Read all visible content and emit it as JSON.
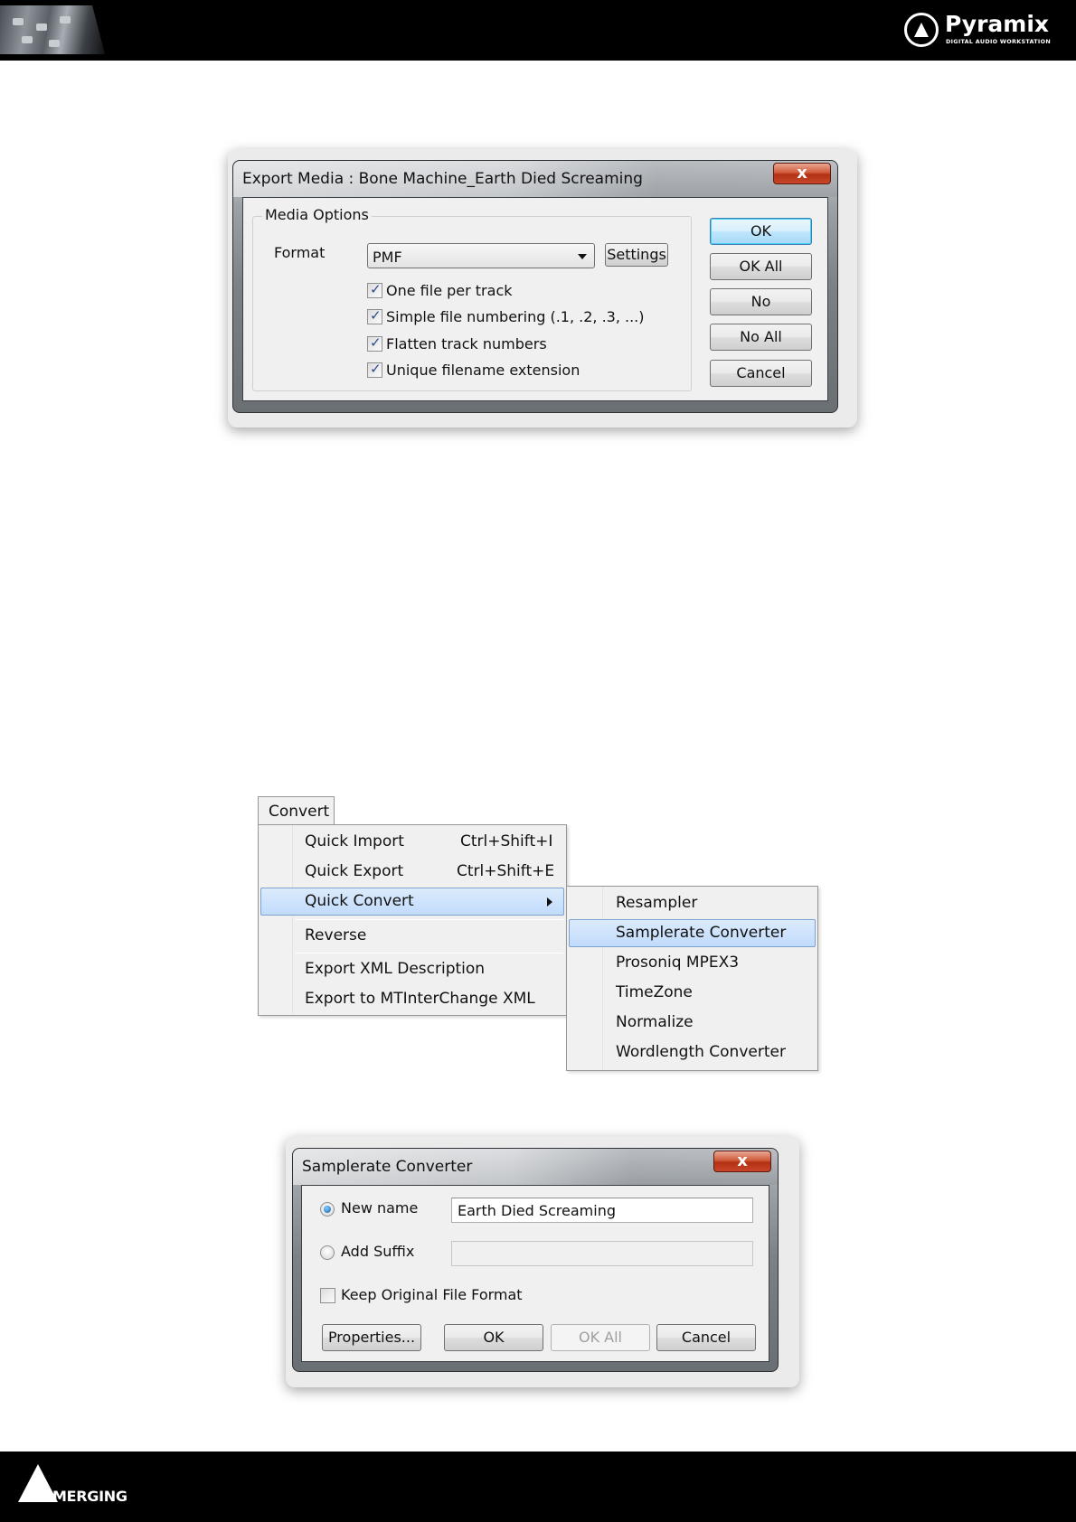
{
  "header": {
    "brand_name": "Pyramix",
    "brand_subtitle": "DIGITAL AUDIO WORKSTATION"
  },
  "footer": {
    "company_name": "MERGING"
  },
  "export_dialog": {
    "title": "Export Media : Bone Machine_Earth Died Screaming",
    "close_label": "x",
    "group_label": "Media Options",
    "format_label": "Format",
    "format_value": "PMF",
    "settings_button": "Settings",
    "options": [
      {
        "label": "One file per track",
        "checked": true
      },
      {
        "label": "Simple file numbering (.1, .2, .3, ...)",
        "checked": true
      },
      {
        "label": "Flatten track numbers",
        "checked": true
      },
      {
        "label": "Unique filename extension",
        "checked": true
      }
    ],
    "buttons": {
      "ok": "OK",
      "ok_all": "OK All",
      "no": "No",
      "no_all": "No All",
      "cancel": "Cancel"
    }
  },
  "convert_menu": {
    "menu_title": "Convert",
    "items": [
      {
        "label": "Quick Import",
        "shortcut": "Ctrl+Shift+I"
      },
      {
        "label": "Quick Export",
        "shortcut": "Ctrl+Shift+E"
      },
      {
        "label": "Quick Convert",
        "shortcut": "",
        "submenu": true,
        "highlighted": true
      },
      {
        "label": "Reverse",
        "shortcut": ""
      },
      {
        "label": "Export XML Description",
        "shortcut": ""
      },
      {
        "label": "Export to MTInterChange XML",
        "shortcut": ""
      }
    ],
    "submenu_items": [
      {
        "label": "Resampler"
      },
      {
        "label": "Samplerate Converter",
        "highlighted": true
      },
      {
        "label": "Prosoniq MPEX3"
      },
      {
        "label": "TimeZone"
      },
      {
        "label": "Normalize"
      },
      {
        "label": "Wordlength Converter"
      }
    ]
  },
  "samplerate_dialog": {
    "title": "Samplerate Converter",
    "close_label": "x",
    "new_name_label": "New name",
    "new_name_value": "Earth Died Screaming",
    "add_suffix_label": "Add Suffix",
    "add_suffix_value": "",
    "keep_format_label": "Keep Original File Format",
    "keep_format_checked": false,
    "buttons": {
      "properties": "Properties...",
      "ok": "OK",
      "ok_all": "OK All",
      "cancel": "Cancel"
    }
  }
}
